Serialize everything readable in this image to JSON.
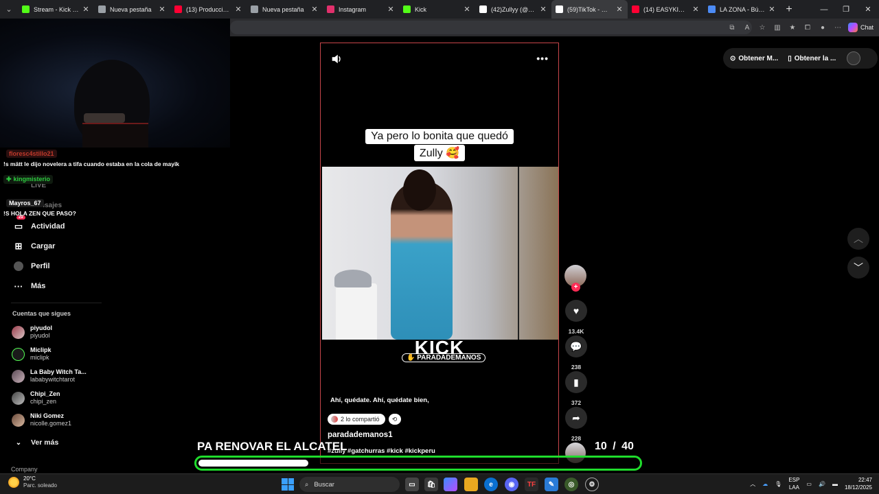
{
  "browser": {
    "tabs": [
      {
        "title": "Stream - Kick Dashb",
        "favicon": "kick-icon",
        "color": "#53fc18",
        "active": false
      },
      {
        "title": "Nueva pestaña",
        "favicon": "newtab-icon",
        "color": "#9aa0a6",
        "active": false
      },
      {
        "title": "(13) Producciones le",
        "favicon": "youtube-icon",
        "color": "#ff0033",
        "active": false
      },
      {
        "title": "Nueva pestaña",
        "favicon": "newtab-icon",
        "color": "#9aa0a6",
        "active": false
      },
      {
        "title": "Instagram",
        "favicon": "instagram-icon",
        "color": "#e1306c",
        "active": false
      },
      {
        "title": "Kick",
        "favicon": "kick-icon",
        "color": "#53fc18",
        "active": false
      },
      {
        "title": "(42)Zullyy (@zullyy_",
        "favicon": "tiktok-icon",
        "color": "#ffffff",
        "active": false
      },
      {
        "title": "(59)TikTok - Make Yo",
        "favicon": "tiktok-icon",
        "color": "#ffffff",
        "active": true
      },
      {
        "title": "(14) EASYKID - S",
        "favicon": "youtube-icon",
        "color": "#ff0033",
        "active": false
      },
      {
        "title": "LA ZONA - Búsqueda",
        "favicon": "search-icon",
        "color": "#4c8bf5",
        "active": false
      }
    ],
    "copilot_label": "Chat"
  },
  "chat": {
    "messages": [
      {
        "user": "floresc4stillo21",
        "user_color": "#c0392b",
        "text": "!s mätt le dijo novelera a tifa cuando estaba en la cola de mayik"
      },
      {
        "user": "kingmisterio",
        "user_color": "#2ecc40",
        "text": ""
      },
      {
        "user": "Mayros_67",
        "user_color": "#ffffff",
        "text": "!S HOLA ZEN QUE PASO?"
      }
    ],
    "ghost_live": "LIVE",
    "ghost_mensajes": "Mensajes"
  },
  "sidebar": {
    "nav": [
      {
        "label": "Actividad",
        "icon": "activity-icon",
        "badge": "29"
      },
      {
        "label": "Cargar",
        "icon": "upload-icon",
        "badge": ""
      },
      {
        "label": "Perfil",
        "icon": "profile-icon",
        "badge": ""
      },
      {
        "label": "Más",
        "icon": "more-icon",
        "badge": ""
      }
    ],
    "following_title": "Cuentas que sigues",
    "following": [
      {
        "name": "piyudol",
        "handle": "piyudol"
      },
      {
        "name": "Miclipk",
        "handle": "miclipk"
      },
      {
        "name": "La Baby Witch Ta...",
        "handle": "lababywitchtarot"
      },
      {
        "name": "Chipi_Zen",
        "handle": "chipi_zen"
      },
      {
        "name": "Niki Gomez",
        "handle": "nicolle.gomez1"
      }
    ],
    "see_more": "Ver más",
    "company": "Company"
  },
  "video": {
    "caption": "Ya pero lo bonita que quedó Zully 🥰",
    "caption_line1": "Ya pero lo bonita que quedó",
    "caption_line2": "Zully 🥰",
    "watermark": "KICK",
    "watermark_tag": "PARADADEMANOS",
    "description": "Ahí, quédate. Ahí, quédate bien,",
    "shared": "2 lo compartió",
    "author": "paradademanos1",
    "hashtags": "#zully #gatchurras #kick #kickperu"
  },
  "actions": {
    "likes": "13.4K",
    "comments": "238",
    "saves": "372",
    "shares": "228"
  },
  "header_buttons": {
    "get_1": "Obtener M...",
    "get_2": "Obtener la ..."
  },
  "overlay": {
    "goal_text": "PA RENOVAR EL ALCATEL",
    "goal_current": "10",
    "goal_total": "/ 40",
    "progress_fraction": 0.25,
    "progress_border_color": "#1fdc2c"
  },
  "taskbar": {
    "temp": "20°C",
    "weather": "Parc. soleado",
    "search_placeholder": "Buscar",
    "lang1": "ESP",
    "lang2": "LAA",
    "time": "22:47",
    "date": "18/12/2025"
  }
}
